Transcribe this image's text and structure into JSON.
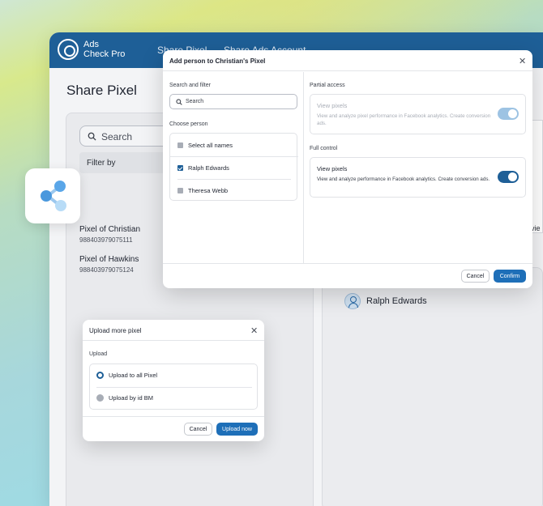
{
  "app": {
    "logo_line1": "Ads",
    "logo_line2": "Check Pro",
    "nav": [
      "Share Pixel",
      "Share Ads Account"
    ],
    "page_title": "Share Pixel",
    "search_placeholder": "Search",
    "filter_label": "Filter by",
    "pixels": [
      {
        "name": "Pixel of Christian",
        "id": "988403979075111"
      },
      {
        "name": "Pixel of Hawkins",
        "id": "988403979075124"
      }
    ],
    "partial_text": "vie",
    "selected_person": "Ralph Edwards"
  },
  "add_person_modal": {
    "title": "Add person to Christian's Pixel",
    "search_filter_label": "Search and filter",
    "search_placeholder": "Search",
    "choose_person_label": "Choose person",
    "people": [
      {
        "label": "Select all names",
        "checked": false
      },
      {
        "label": "Ralph Edwards",
        "checked": true
      },
      {
        "label": "Theresa Webb",
        "checked": false
      }
    ],
    "partial_access_label": "Partial access",
    "partial_access": {
      "title": "View pixels",
      "description": "View and analyze pixel performance in Facebook analytics. Create conversion ads.",
      "enabled": true,
      "disabled": true
    },
    "full_control_label": "Full control",
    "full_control": {
      "title": "View pixels",
      "description": "View and analyze performance in Facebook analytics. Create conversion ads.",
      "enabled": true
    },
    "cancel_label": "Cancel",
    "confirm_label": "Confirm"
  },
  "upload_modal": {
    "title": "Upload more pixel",
    "upload_label": "Upload",
    "options": [
      {
        "label": "Upload to all Pixel",
        "selected": true
      },
      {
        "label": "Upload by id BM",
        "selected": false
      }
    ],
    "cancel_label": "Cancel",
    "submit_label": "Upload now"
  },
  "colors": {
    "brand": "#1e5f97",
    "primary_button": "#1e6fb8",
    "toggle_disabled": "#9dc3e3"
  }
}
